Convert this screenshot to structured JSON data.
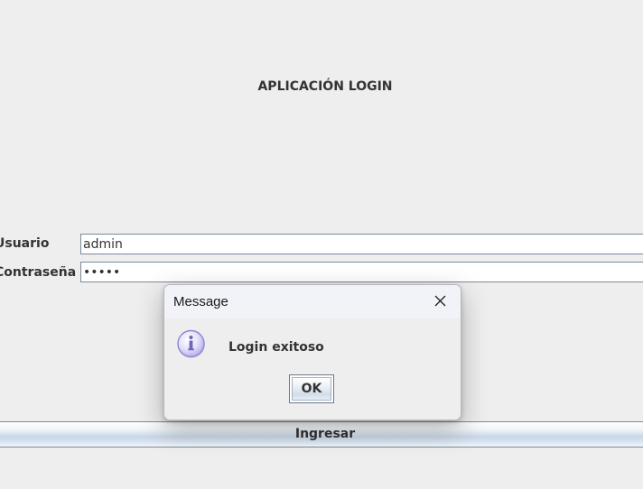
{
  "app": {
    "title": "APLICACIÓN LOGIN"
  },
  "form": {
    "user_label": "Usuario",
    "user_value": "admin",
    "password_label": "Contraseña",
    "password_value": "•••••",
    "submit_label": "Ingresar"
  },
  "dialog": {
    "title": "Message",
    "message": "Login exitoso",
    "ok_label": "OK",
    "icon": "info-icon",
    "close_icon": "close-icon"
  },
  "colors": {
    "background": "#eeeeee",
    "dialog_titlebar": "#f2f3f9",
    "info_icon": "#8d86d6"
  }
}
